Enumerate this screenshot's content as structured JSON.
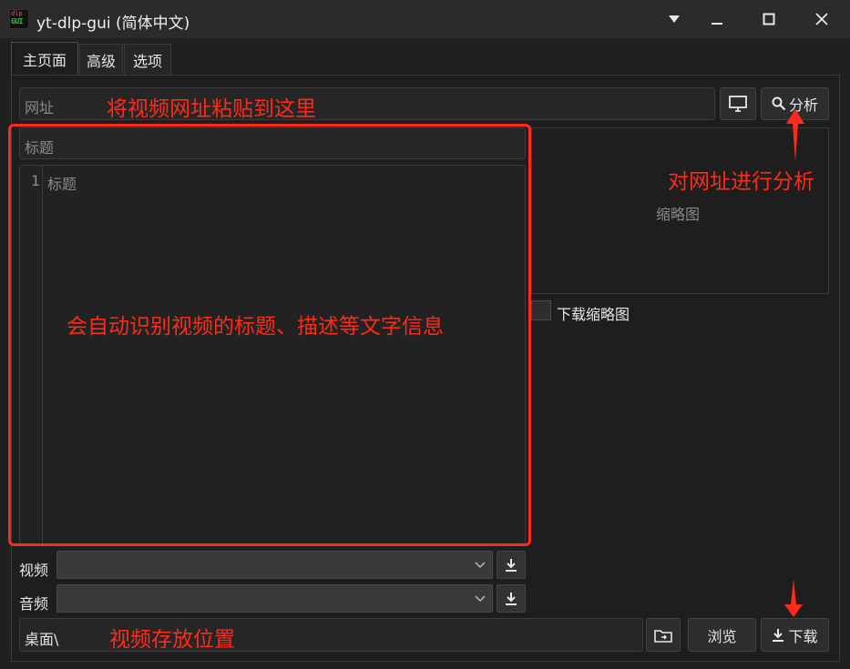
{
  "window": {
    "title": "yt-dlp-gui (简体中文)",
    "icon": "yt-dlp-gui-app-icon",
    "icon_text_top": "dlp",
    "icon_text_bottom": "GUI"
  },
  "tabs": [
    {
      "label": "主页面",
      "active": true
    },
    {
      "label": "高级",
      "active": false
    },
    {
      "label": "选项",
      "active": false
    }
  ],
  "url_field": {
    "placeholder": "网址",
    "value": ""
  },
  "analyze_button": {
    "label": "分析",
    "icon": "search-icon"
  },
  "monitor_button": {
    "icon": "monitor-icon"
  },
  "title_field": {
    "placeholder": "标题",
    "value": ""
  },
  "description": {
    "line_number": "1",
    "placeholder": "标题"
  },
  "thumbnail": {
    "placeholder": "缩略图"
  },
  "download_thumbnail": {
    "label": "下载缩略图",
    "checked": false
  },
  "video_row": {
    "label": "视频",
    "value": ""
  },
  "audio_row": {
    "label": "音频",
    "value": ""
  },
  "save_path": {
    "value": "桌面\\"
  },
  "browse_button": {
    "label": "浏览"
  },
  "download_button": {
    "label": "下载",
    "icon": "download-icon"
  },
  "annotations": {
    "url_hint": "将视频网址粘贴到这里",
    "analyze_hint": "对网址进行分析",
    "info_hint": "会自动识别视频的标题、描述等文字信息",
    "save_hint": "视频存放位置",
    "color": "#ff2a1a"
  }
}
